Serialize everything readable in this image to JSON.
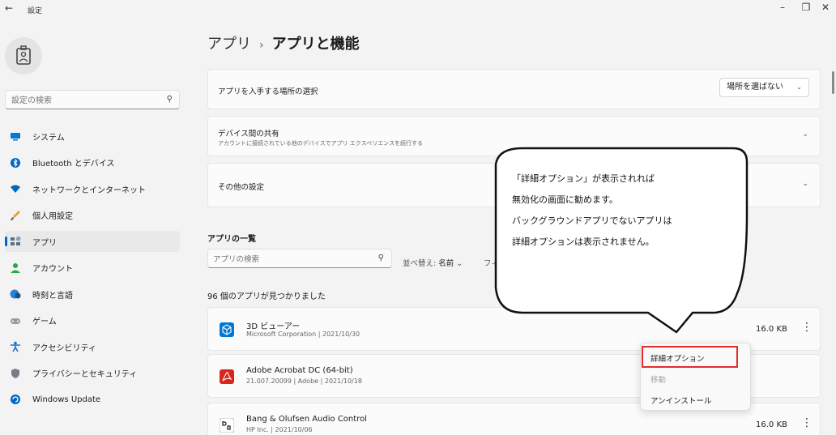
{
  "window": {
    "title": "設定",
    "back_icon": "arrow-left-icon"
  },
  "search": {
    "placeholder": "設定の検索"
  },
  "nav": [
    {
      "label": "システム",
      "icon": "monitor-icon",
      "color": "#0078d4"
    },
    {
      "label": "Bluetooth とデバイス",
      "icon": "bluetooth-icon",
      "color": "#0067c0"
    },
    {
      "label": "ネットワークとインターネット",
      "icon": "wifi-icon",
      "color": "#0067c0"
    },
    {
      "label": "個人用設定",
      "icon": "brush-icon",
      "color": "#e3a13a"
    },
    {
      "label": "アプリ",
      "icon": "apps-icon",
      "color": "#5a6f88"
    },
    {
      "label": "アカウント",
      "icon": "person-icon",
      "color": "#24a94f"
    },
    {
      "label": "時刻と言語",
      "icon": "globe-clock-icon",
      "color": "#2d7fd1"
    },
    {
      "label": "ゲーム",
      "icon": "gamepad-icon",
      "color": "#8a8a8a"
    },
    {
      "label": "アクセシビリティ",
      "icon": "accessibility-icon",
      "color": "#1a6fd1"
    },
    {
      "label": "プライバシーとセキュリティ",
      "icon": "shield-icon",
      "color": "#7a7a8a"
    },
    {
      "label": "Windows Update",
      "icon": "update-icon",
      "color": "#0067c0"
    }
  ],
  "breadcrumb": {
    "parent": "アプリ",
    "current": "アプリと機能"
  },
  "cards": {
    "source": {
      "title": "アプリを入手する場所の選択",
      "dropdown_value": "場所を選ばない"
    },
    "share": {
      "title": "デバイス間の共有",
      "subtitle": "アカウントに接続されている他のデバイスでアプリ エクスペリエンスを続行する"
    },
    "other": {
      "title": "その他の設定"
    }
  },
  "app_list": {
    "heading": "アプリの一覧",
    "search_placeholder": "アプリの検索",
    "sort_label": "並べ替え:",
    "sort_value": "名前",
    "filter_label": "フィ",
    "count_text": "96 個のアプリが見つかりました",
    "apps": [
      {
        "name": "3D ビューアー",
        "meta": "Microsoft Corporation  |  2021/10/30",
        "size": "16.0 KB",
        "icon": "cube-icon",
        "color": "#0078d4"
      },
      {
        "name": "Adobe Acrobat DC (64-bit)",
        "meta": "21.007.20099  |  Adobe  |  2021/10/18",
        "size": "",
        "icon": "acrobat-icon",
        "color": "#d7261e"
      },
      {
        "name": "Bang & Olufsen Audio Control",
        "meta": "HP Inc.  |  2021/10/06",
        "size": "16.0 KB",
        "icon": "bo-logo-icon",
        "color": "#1b1b1b"
      }
    ]
  },
  "context_menu": {
    "items": [
      "詳細オプション",
      "移動",
      "アンインストール"
    ]
  },
  "callout": {
    "lines": [
      "「詳細オプション」が表示されれば",
      "無効化の画面に勧めます。",
      "バックグラウンドアプリでないアプリは",
      "詳細オプションは表示されません。"
    ]
  }
}
